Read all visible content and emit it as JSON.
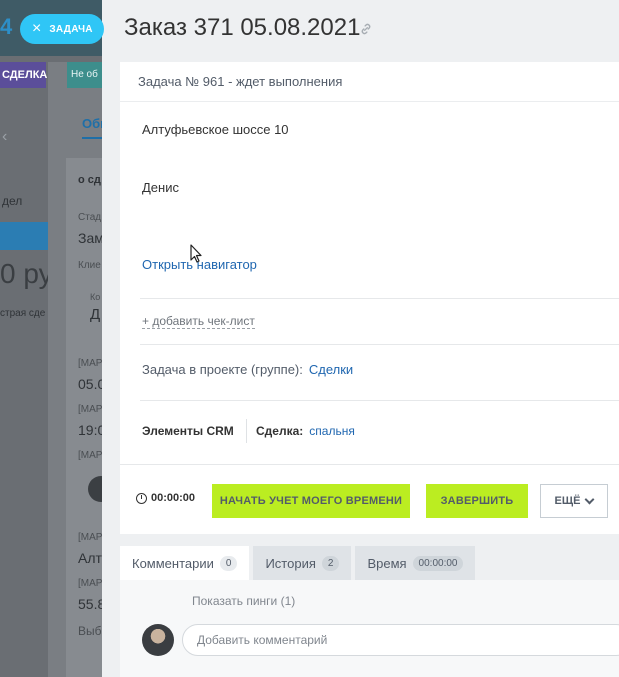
{
  "background": {
    "number": "4",
    "deal_button": "СДЕЛКА",
    "status": "Не об",
    "tab": "Общ",
    "items": [
      "о сд",
      "Стад",
      "Зам",
      "Клие",
      "Ко",
      "Д",
      "[МАР",
      "05.0",
      "[МАР",
      "19:0",
      "[МАР",
      "[МАР",
      "Алт",
      "[МАР",
      "55.8",
      "Выбр"
    ],
    "left_texts": [
      "дел",
      "0 руб",
      "страя сде"
    ]
  },
  "slider": {
    "close_label": "ЗАДАЧА",
    "title": "Заказ 371 05.08.2021"
  },
  "task": {
    "header": "Задача № 961 - ждет выполнения",
    "description_line1": "Алтуфьевское шоссе 10",
    "description_line2": "Денис",
    "navigator_link": "Открыть навигатор",
    "checklist_link": "+ добавить чек-лист",
    "project_label": "Задача в проекте (группе):",
    "project_value": "Сделки",
    "crm_label": "Элементы CRM",
    "crm_deal_label": "Сделка:",
    "crm_deal_value": "спальня"
  },
  "actions": {
    "timer": "00:00:00",
    "start_time": "НАЧАТЬ УЧЕТ МОЕГО ВРЕМЕНИ",
    "finish": "ЗАВЕРШИТЬ",
    "more": "ЕЩЁ"
  },
  "tabs": [
    {
      "label": "Комментарии",
      "count": "0"
    },
    {
      "label": "История",
      "count": "2"
    },
    {
      "label": "Время",
      "count": "00:00:00"
    }
  ],
  "comments": {
    "show_pings": "Показать пинги (1)",
    "placeholder": "Добавить комментарий"
  },
  "colors": {
    "accent_green": "#bbed21",
    "close_button": "#2fc6f6",
    "link": "#2067b0"
  }
}
